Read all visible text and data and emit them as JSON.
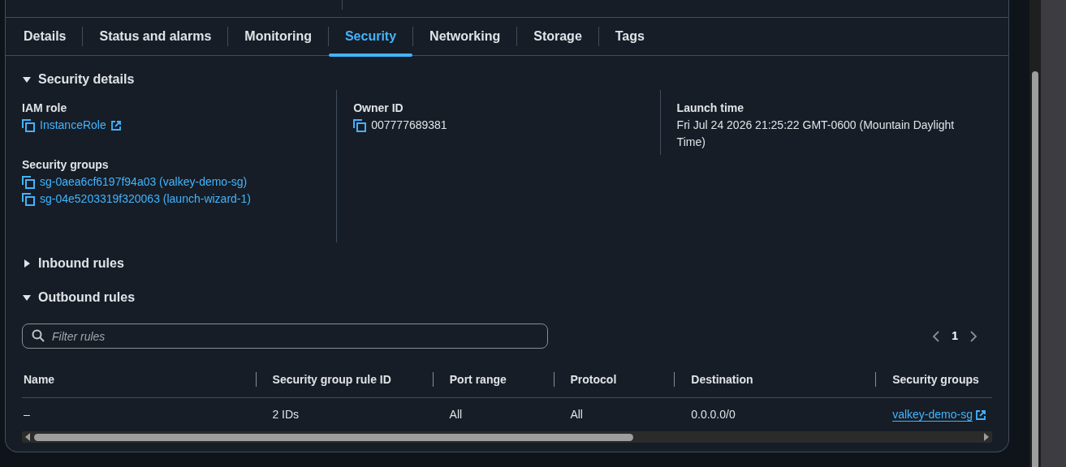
{
  "tabs": [
    {
      "label": "Details",
      "selected": false
    },
    {
      "label": "Status and alarms",
      "selected": false
    },
    {
      "label": "Monitoring",
      "selected": false
    },
    {
      "label": "Security",
      "selected": true
    },
    {
      "label": "Networking",
      "selected": false
    },
    {
      "label": "Storage",
      "selected": false
    },
    {
      "label": "Tags",
      "selected": false
    }
  ],
  "security_details": {
    "title": "Security details",
    "expanded": true,
    "columns": [
      {
        "fields": [
          {
            "label": "IAM role",
            "values": [
              {
                "text": "InstanceRole",
                "kind": "link",
                "external": true
              }
            ]
          },
          {
            "label": "Security groups",
            "values": [
              {
                "text": "sg-0aea6cf6197f94a03 (valkey-demo-sg)",
                "kind": "link",
                "external": false
              },
              {
                "text": "sg-04e5203319f320063 (launch-wizard-1)",
                "kind": "link",
                "external": false
              }
            ]
          }
        ]
      },
      {
        "fields": [
          {
            "label": "Owner ID",
            "values": [
              {
                "text": "007777689381",
                "kind": "text",
                "external": false
              }
            ]
          }
        ]
      },
      {
        "fields": [
          {
            "label": "Launch time",
            "values": [
              {
                "text": "Fri Jul 24 2026 21:25:22 GMT-0600 (Mountain Daylight Time)",
                "kind": "plain",
                "external": false
              }
            ]
          }
        ]
      }
    ]
  },
  "inbound_rules": {
    "title": "Inbound rules",
    "expanded": false
  },
  "outbound_rules": {
    "title": "Outbound rules",
    "expanded": true,
    "filter": {
      "placeholder": "Filter rules"
    },
    "pagination": {
      "page": "1"
    },
    "table": {
      "columns": [
        "Name",
        "Security group rule ID",
        "Port range",
        "Protocol",
        "Destination",
        "Security groups"
      ],
      "rows": [
        [
          "–",
          "2 IDs",
          "All",
          "All",
          "0.0.0.0/0",
          "valkey-demo-sg"
        ]
      ]
    }
  }
}
